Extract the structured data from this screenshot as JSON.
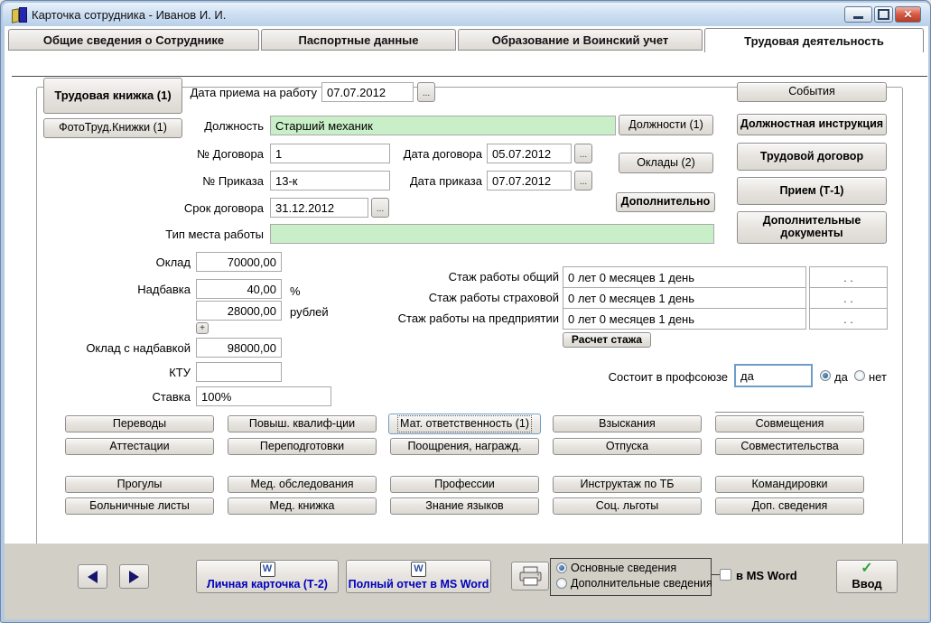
{
  "window": {
    "title": "Карточка сотрудника -  Иванов И. И."
  },
  "tabs": [
    {
      "label": "Общие сведения о Сотруднике"
    },
    {
      "label": "Паспортные данные"
    },
    {
      "label": "Образование и Воинский учет"
    },
    {
      "label": "Трудовая деятельность"
    }
  ],
  "left_buttons": {
    "work_book": "Трудовая книжка (1)",
    "photo_book": "ФотоТруд.Книжки (1)"
  },
  "form": {
    "hire_date_label": "Дата приема на работу",
    "hire_date": "07.07.2012",
    "position_label": "Должность",
    "position": "Старший механик",
    "contract_no_label": "№ Договора",
    "contract_no": "1",
    "contract_date_label": "Дата договора",
    "contract_date": "05.07.2012",
    "order_no_label": "№ Приказа",
    "order_no": "13-к",
    "order_date_label": "Дата приказа",
    "order_date": "07.07.2012",
    "term_label": "Срок договора",
    "term": "31.12.2012",
    "workplace_label": "Тип места работы",
    "workplace": "",
    "ellipsis": "...",
    "plus": "+"
  },
  "salary": {
    "salary_label": "Оклад",
    "salary": "70000,00",
    "bonus_label": "Надбавка",
    "bonus_percent": "40,00",
    "percent_suffix": "%",
    "bonus_rub": "28000,00",
    "rub_suffix": "рублей",
    "total_label": "Оклад с надбавкой",
    "total": "98000,00",
    "ktu_label": "КТУ",
    "ktu": "",
    "rate_label": "Ставка",
    "rate": "100%"
  },
  "mid_buttons": {
    "positions": "Должности (1)",
    "salaries": "Оклады (2)",
    "additional": "Дополнительно"
  },
  "right_buttons": {
    "events": "События",
    "job_description": "Должностная инструкция",
    "labor_contract": "Трудовой договор",
    "hiring": "Прием (Т-1)",
    "additional_docs": "Дополнительные документы"
  },
  "experience": {
    "rows": [
      {
        "label": "Стаж работы общий",
        "value": "0 лет 0 месяцев 1 день",
        "date": ". ."
      },
      {
        "label": "Стаж работы страховой",
        "value": "0 лет 0 месяцев 1 день",
        "date": ". ."
      },
      {
        "label": "Стаж работы на предприятии",
        "value": "0 лет 0 месяцев 1 день",
        "date": ". ."
      }
    ],
    "calc_button": "Расчет стажа"
  },
  "union": {
    "label": "Состоит в профсоюзе",
    "value": "да",
    "yes": "да",
    "no": "нет"
  },
  "grid": {
    "rows": [
      [
        "Переводы",
        "Повыш. квалиф-ции",
        "Мат. ответственность (1)",
        "Взыскания",
        "Совмещения"
      ],
      [
        "Аттестации",
        "Переподготовки",
        "Поощрения, награжд.",
        "Отпуска",
        "Совместительства"
      ],
      [
        "Прогулы",
        "Мед. обследования",
        "Профессии",
        "Инструктаж по ТБ",
        "Командировки"
      ],
      [
        "Больничные листы",
        "Мед. книжка",
        "Знание языков",
        "Соц. льготы",
        "Доп. сведения"
      ]
    ]
  },
  "footer": {
    "personal_card": "Личная карточка (Т-2)",
    "full_report": "Полный отчет в MS Word",
    "radio_main": "Основные сведения",
    "radio_additional": "Дополнительные сведения",
    "ms_word_checkbox": "в MS Word",
    "enter_button": "Ввод",
    "check_glyph": "✓",
    "word_icon_letter": "W"
  },
  "colors": {
    "green_field": "#c9efc9",
    "focus_border": "#6f9dc8",
    "blue_button_text": "#0000bb",
    "check_green": "#2ea43a",
    "footer_bg": "#d2cfc6"
  }
}
